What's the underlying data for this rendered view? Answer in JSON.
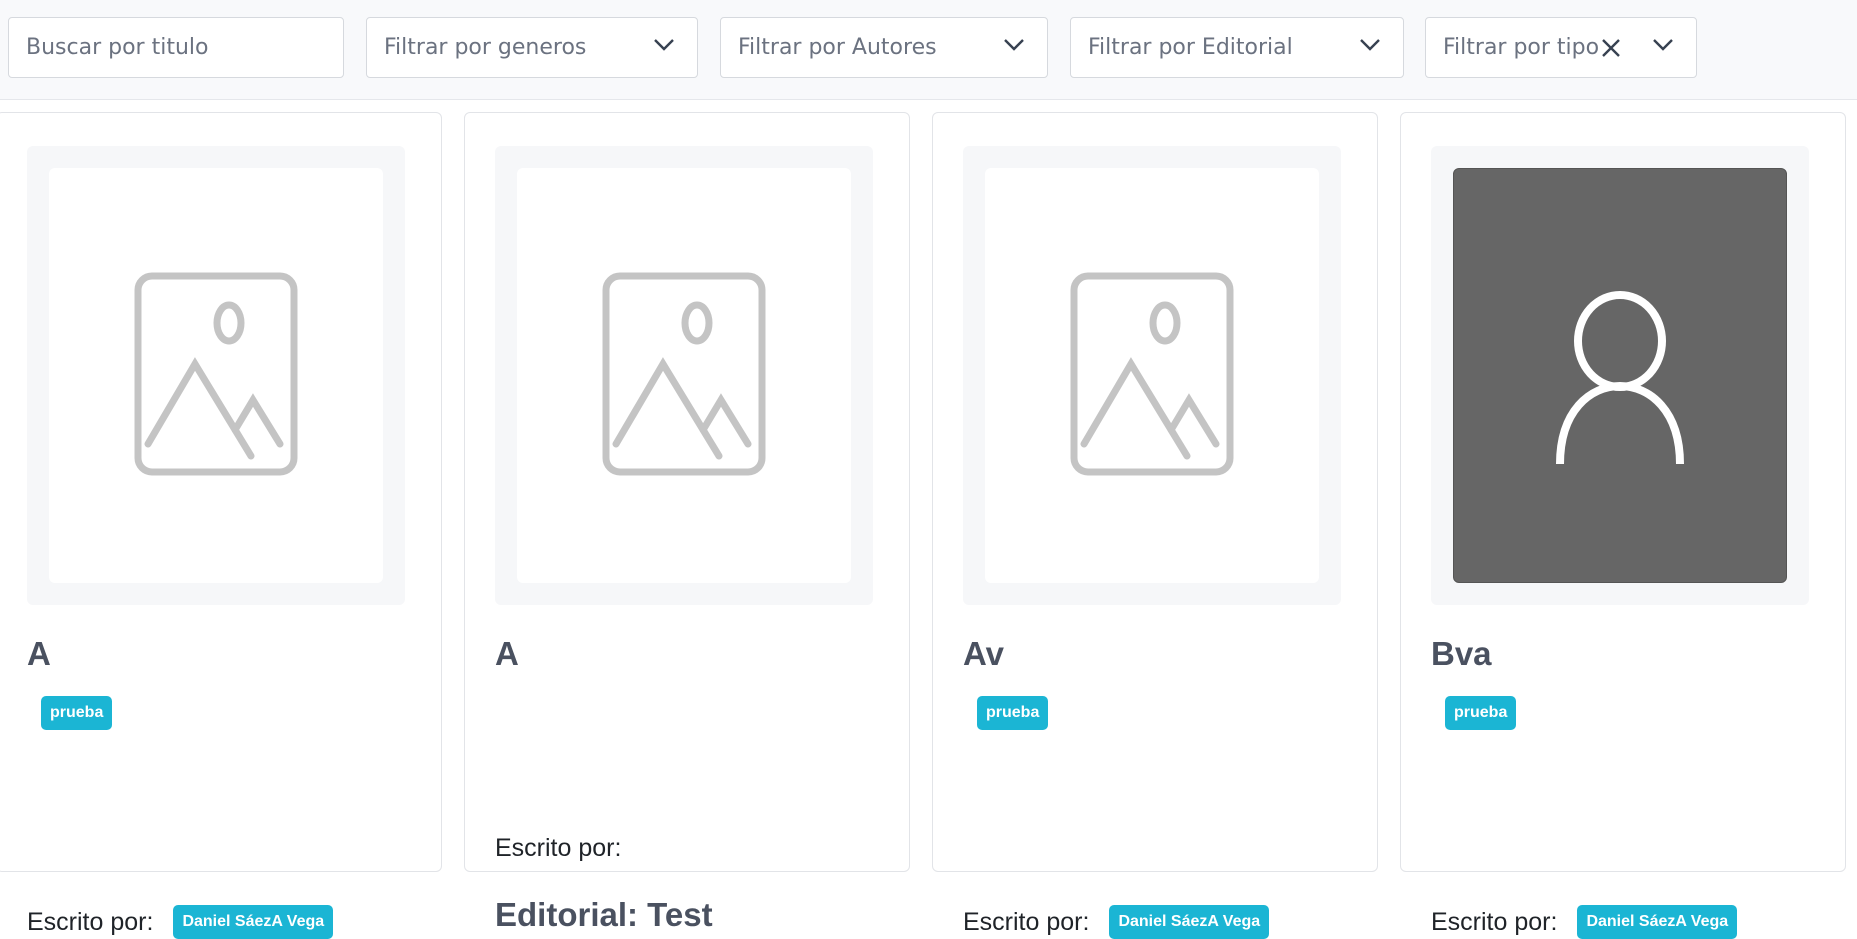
{
  "filters": {
    "search_placeholder": "Buscar por titulo",
    "genres": "Filtrar por generos",
    "authors": "Filtrar por Autores",
    "publisher": "Filtrar por Editorial",
    "type": "Filtrar por tipo"
  },
  "cards": [
    {
      "title": "A",
      "genre": "prueba",
      "author_label": "Escrito por:",
      "author": "Daniel SáezA Vega",
      "image": "image-placeholder-icon"
    },
    {
      "title": "A",
      "author_label": "Escrito por:",
      "editorial": "Editorial: Test",
      "image": "image-placeholder-icon"
    },
    {
      "title": "Av",
      "genre": "prueba",
      "author_label": "Escrito por:",
      "author": "Daniel SáezA Vega",
      "image": "image-placeholder-icon"
    },
    {
      "title": "Bva",
      "genre": "prueba",
      "author_label": "Escrito por:",
      "author": "Daniel SáezA Vega",
      "image": "user-avatar-icon"
    }
  ],
  "colors": {
    "badge": "#1bb5d4",
    "avatar_bg": "#666666"
  }
}
